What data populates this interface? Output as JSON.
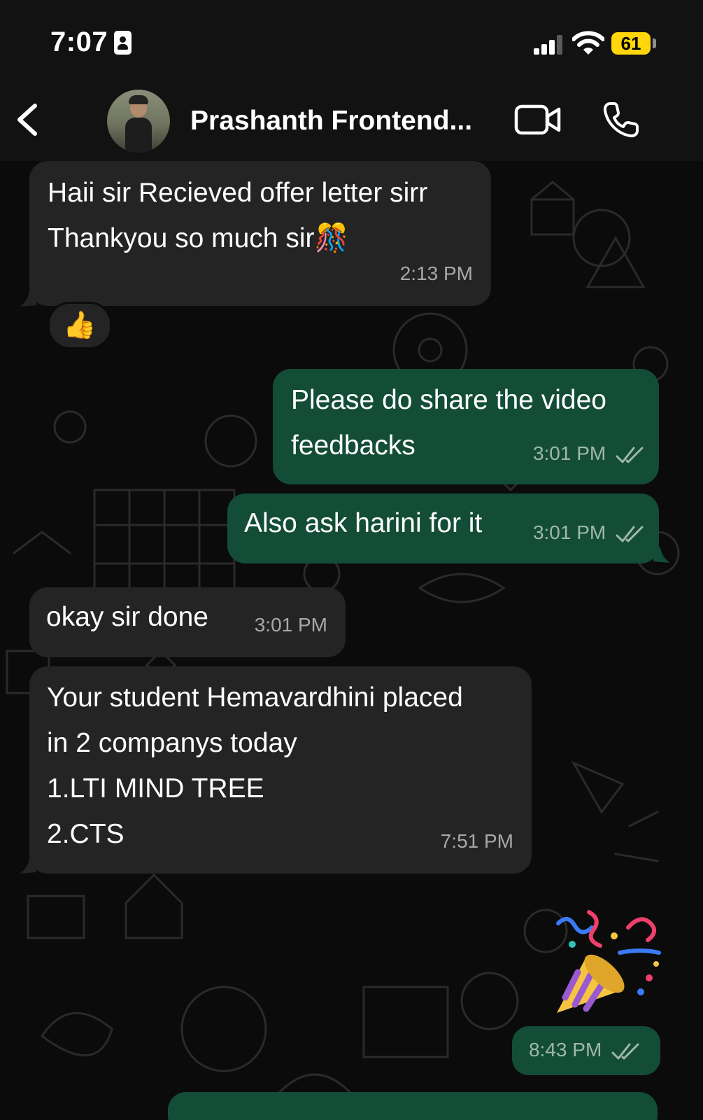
{
  "status_bar": {
    "time": "7:07",
    "battery": "61"
  },
  "header": {
    "contact_name": "Prashanth Frontend..."
  },
  "messages": [
    {
      "direction": "incoming",
      "text": "Haii sir Recieved offer letter sirr\nThankyou so much sir🎊",
      "time": "2:13 PM",
      "reaction": "👍"
    },
    {
      "direction": "outgoing",
      "text": "Please do share the video\nfeedbacks",
      "time": "3:01 PM",
      "status": "read"
    },
    {
      "direction": "outgoing",
      "text": "Also ask harini for it",
      "time": "3:01 PM",
      "status": "read"
    },
    {
      "direction": "incoming",
      "text": "okay sir done",
      "time": "3:01 PM"
    },
    {
      "direction": "incoming",
      "text": "Your student Hemavardhini placed\nin 2 companys today\n1.LTI MIND TREE\n2.CTS",
      "time": "7:51 PM"
    },
    {
      "direction": "outgoing",
      "sticker": "party-popper",
      "time": "8:43 PM",
      "status": "read"
    }
  ],
  "colors": {
    "incoming_bubble": "#242424",
    "outgoing_bubble": "#144d37",
    "background": "#0b0b0b",
    "header": "#121212",
    "battery": "#ffd60a",
    "read_tick": "#9fb8ab"
  }
}
